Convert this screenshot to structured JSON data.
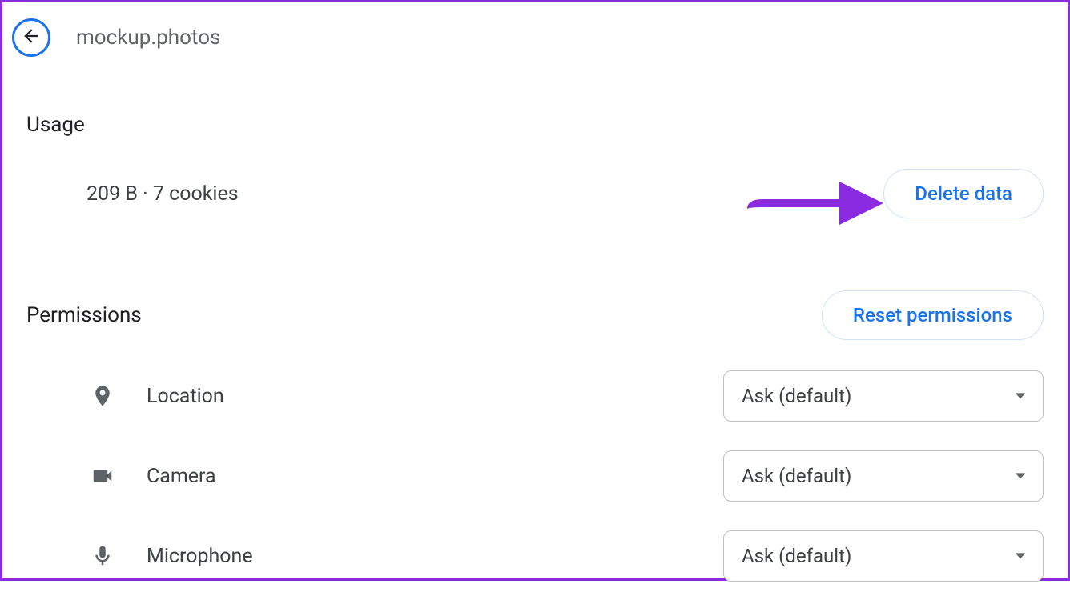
{
  "header": {
    "site_title": "mockup.photos"
  },
  "usage": {
    "heading": "Usage",
    "data_text": "209 B · 7 cookies",
    "delete_label": "Delete data"
  },
  "permissions": {
    "heading": "Permissions",
    "reset_label": "Reset permissions",
    "items": [
      {
        "label": "Location",
        "value": "Ask (default)"
      },
      {
        "label": "Camera",
        "value": "Ask (default)"
      },
      {
        "label": "Microphone",
        "value": "Ask (default)"
      }
    ]
  },
  "colors": {
    "accent": "#1a73e8",
    "annotation": "#8a2be2"
  }
}
